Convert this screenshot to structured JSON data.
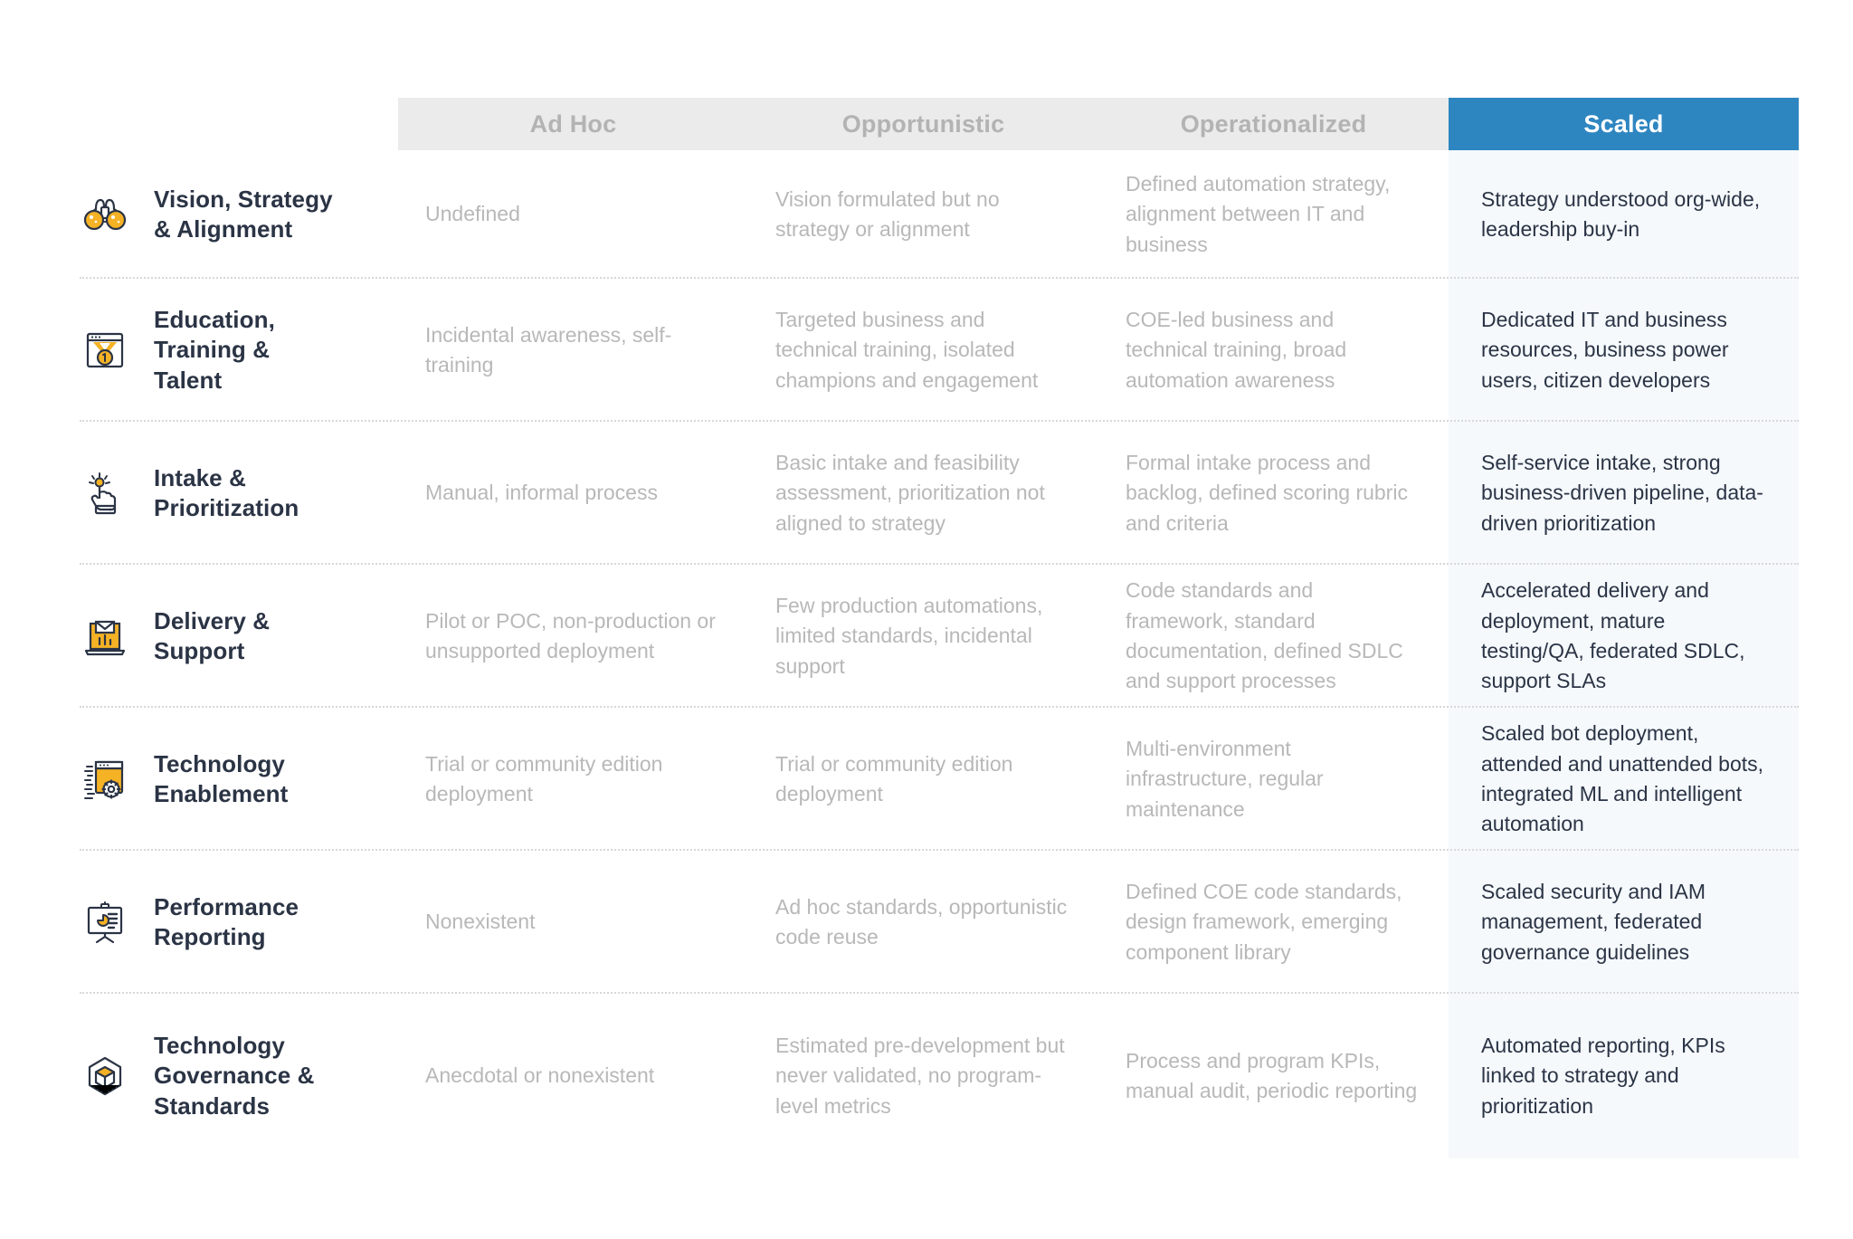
{
  "colors": {
    "header_inactive_bg": "#ebebeb",
    "header_inactive_text": "#b3b3b3",
    "header_active_bg": "#2e86c1",
    "header_active_text": "#ffffff",
    "scaled_column_bg": "#f5f9fc",
    "body_text_muted": "#b8b8b8",
    "body_text_dark": "#2b3445",
    "icon_outline": "#2b3445",
    "icon_accent": "#f5b225",
    "divider": "#d8d8d8"
  },
  "columns": [
    {
      "key": "ad_hoc",
      "label": "Ad Hoc",
      "active": false
    },
    {
      "key": "opportunistic",
      "label": "Opportunistic",
      "active": false
    },
    {
      "key": "operationalized",
      "label": "Operationalized",
      "active": false
    },
    {
      "key": "scaled",
      "label": "Scaled",
      "active": true
    }
  ],
  "rows": [
    {
      "icon": "binoculars-icon",
      "title": "Vision, Strategy\n& Alignment",
      "title_lines": [
        "Vision, Strategy",
        "& Alignment"
      ],
      "ad_hoc": "Undefined",
      "opportunistic": "Vision formulated but no strategy or alignment",
      "operationalized": "Defined automation strategy, alignment between IT and business",
      "scaled": "Strategy understood org-wide, leadership buy-in"
    },
    {
      "icon": "medal-window-icon",
      "title": "Education, Training & Talent",
      "title_lines": [
        "Education,",
        "Training &",
        "Talent"
      ],
      "ad_hoc": "Incidental awareness, self-training",
      "opportunistic": "Targeted business and technical training, isolated champions and engagement",
      "operationalized": "COE-led business and technical training, broad automation awareness",
      "scaled": "Dedicated IT and business resources, business power users, citizen developers"
    },
    {
      "icon": "pointing-hand-spark-icon",
      "title": "Intake & Prioritization",
      "title_lines": [
        "Intake &",
        "Prioritization"
      ],
      "ad_hoc": "Manual, informal process",
      "opportunistic": "Basic intake and feasibility assessment, prioritization not aligned to strategy",
      "operationalized": "Formal intake process and backlog, defined scoring rubric and criteria",
      "scaled": "Self-service intake, strong business-driven pipeline, data-driven prioritization"
    },
    {
      "icon": "laptop-envelope-icon",
      "title": "Delivery & Support",
      "title_lines": [
        "Delivery &",
        "Support"
      ],
      "ad_hoc": "Pilot or POC, non-production or unsupported deployment",
      "opportunistic": "Few production automations, limited standards, incidental support",
      "operationalized": "Code standards and framework, standard documentation, defined SDLC and support processes",
      "scaled": "Accelerated delivery and deployment, mature testing/QA, federated SDLC, support SLAs"
    },
    {
      "icon": "window-gear-code-icon",
      "title": "Technology Enablement",
      "title_lines": [
        "Technology",
        "Enablement"
      ],
      "ad_hoc": "Trial or community edition deployment",
      "opportunistic": "Trial or community edition deployment",
      "operationalized": "Multi-environment infrastructure, regular maintenance",
      "scaled": "Scaled bot deployment, attended and unattended bots, integrated ML and intelligent automation"
    },
    {
      "icon": "presentation-chart-icon",
      "title": "Performance Reporting",
      "title_lines": [
        "Performance",
        "Reporting"
      ],
      "ad_hoc": "Nonexistent",
      "opportunistic": "Ad hoc standards, opportunistic code reuse",
      "operationalized": "Defined COE code standards, design framework, emerging component library",
      "scaled": "Scaled security and IAM management, federated governance guidelines"
    },
    {
      "icon": "isometric-cube-icon",
      "title": "Technology Governance & Standards",
      "title_lines": [
        "Technology",
        "Governance &",
        "Standards"
      ],
      "ad_hoc": "Anecdotal or nonexistent",
      "opportunistic": "Estimated pre-development but never validated, no program-level metrics",
      "operationalized": "Process and program KPIs, manual audit, periodic reporting",
      "scaled": "Automated reporting, KPIs linked to strategy and prioritization"
    }
  ]
}
